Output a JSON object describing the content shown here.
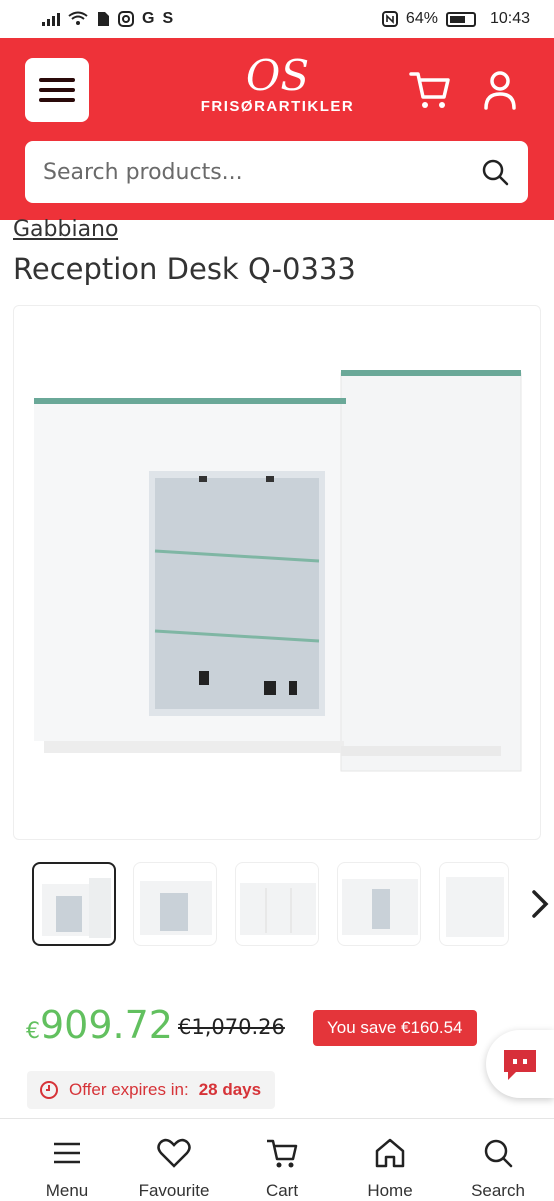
{
  "status_bar": {
    "left_icons": [
      "signal-icon",
      "wifi-icon",
      "file-icon",
      "instagram-icon",
      "g-icon",
      "s-icon"
    ],
    "left_text": [
      "G",
      "S"
    ],
    "right_text": "64%",
    "time": "10:43"
  },
  "header": {
    "logo_main": "OS",
    "logo_sub": "FRISØRARTIKLER",
    "search_placeholder": "Search products..."
  },
  "product": {
    "brand": "Gabbiano",
    "title": "Reception Desk Q-0333",
    "price_currency": "€",
    "price_value": "909.72",
    "old_price": "€1,070.26",
    "save_label": "You save €160.54",
    "offer_label": "Offer expires in:",
    "offer_value": "28 days"
  },
  "bottom_nav": {
    "menu": "Menu",
    "favourite": "Favourite",
    "cart": "Cart",
    "home": "Home",
    "search": "Search"
  },
  "colors": {
    "header": "#ee3239",
    "price": "#62c05f",
    "badge": "#e4353a"
  }
}
